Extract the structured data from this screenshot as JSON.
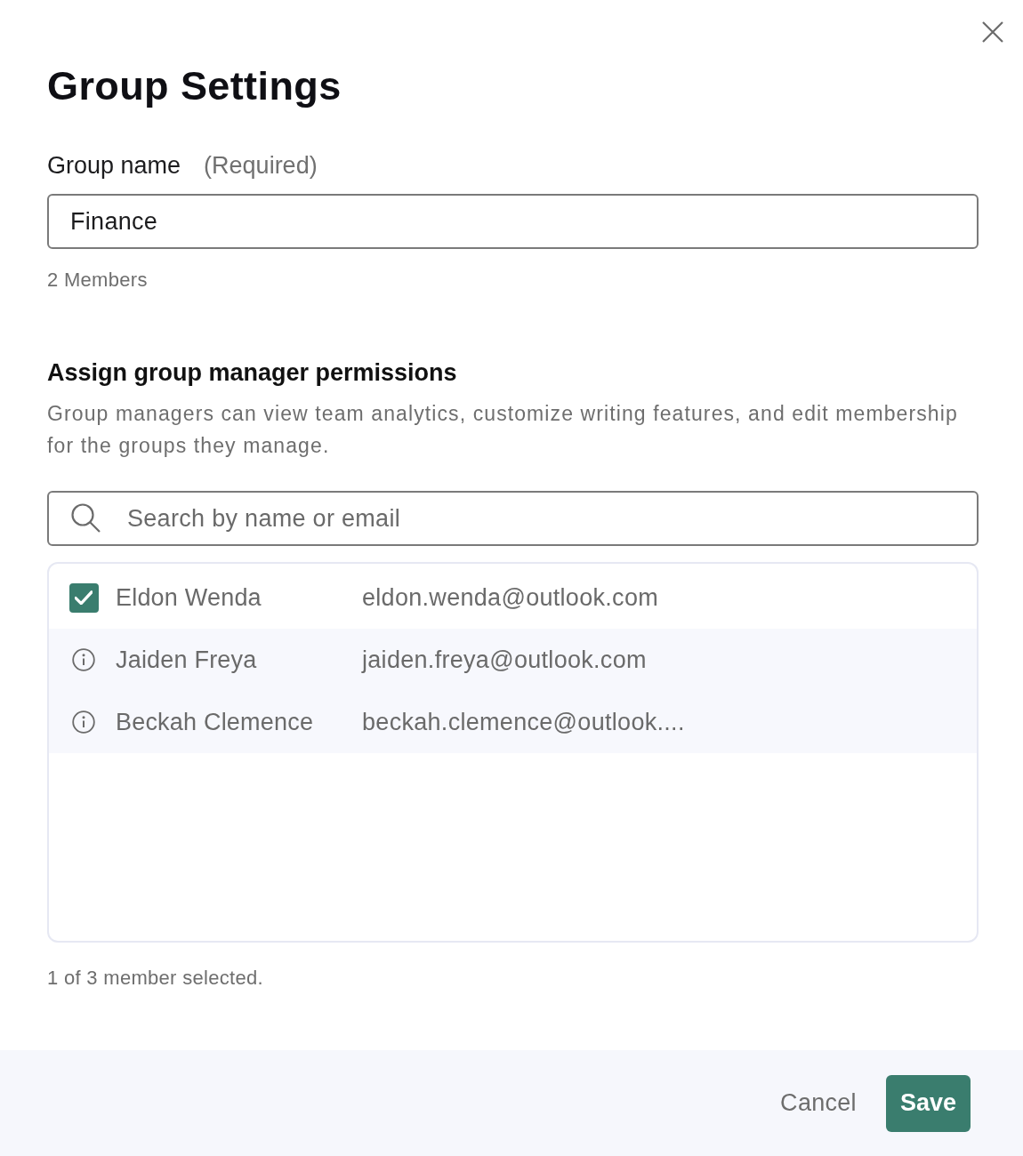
{
  "dialog": {
    "title": "Group Settings"
  },
  "group_name": {
    "label": "Group name",
    "hint": "(Required)",
    "value": "Finance"
  },
  "member_count": "2 Members",
  "permissions": {
    "heading": "Assign group manager permissions",
    "description": "Group managers can view team analytics, customize writing features, and edit membership for the groups they manage.",
    "search": {
      "placeholder": "Search by name or email"
    },
    "members": [
      {
        "kind": "checkbox",
        "checked": true,
        "name": "Eldon Wenda",
        "email": "eldon.wenda@outlook.com"
      },
      {
        "kind": "info",
        "name": "Jaiden Freya",
        "email": "jaiden.freya@outlook.com"
      },
      {
        "kind": "info",
        "name": "Beckah Clemence",
        "email": "beckah.clemence@outlook...."
      }
    ],
    "selection_summary": "1 of 3 member selected."
  },
  "footer": {
    "buttons": [
      {
        "kind": "link",
        "label": "Cancel"
      },
      {
        "kind": "primary",
        "label": "Save"
      }
    ]
  }
}
